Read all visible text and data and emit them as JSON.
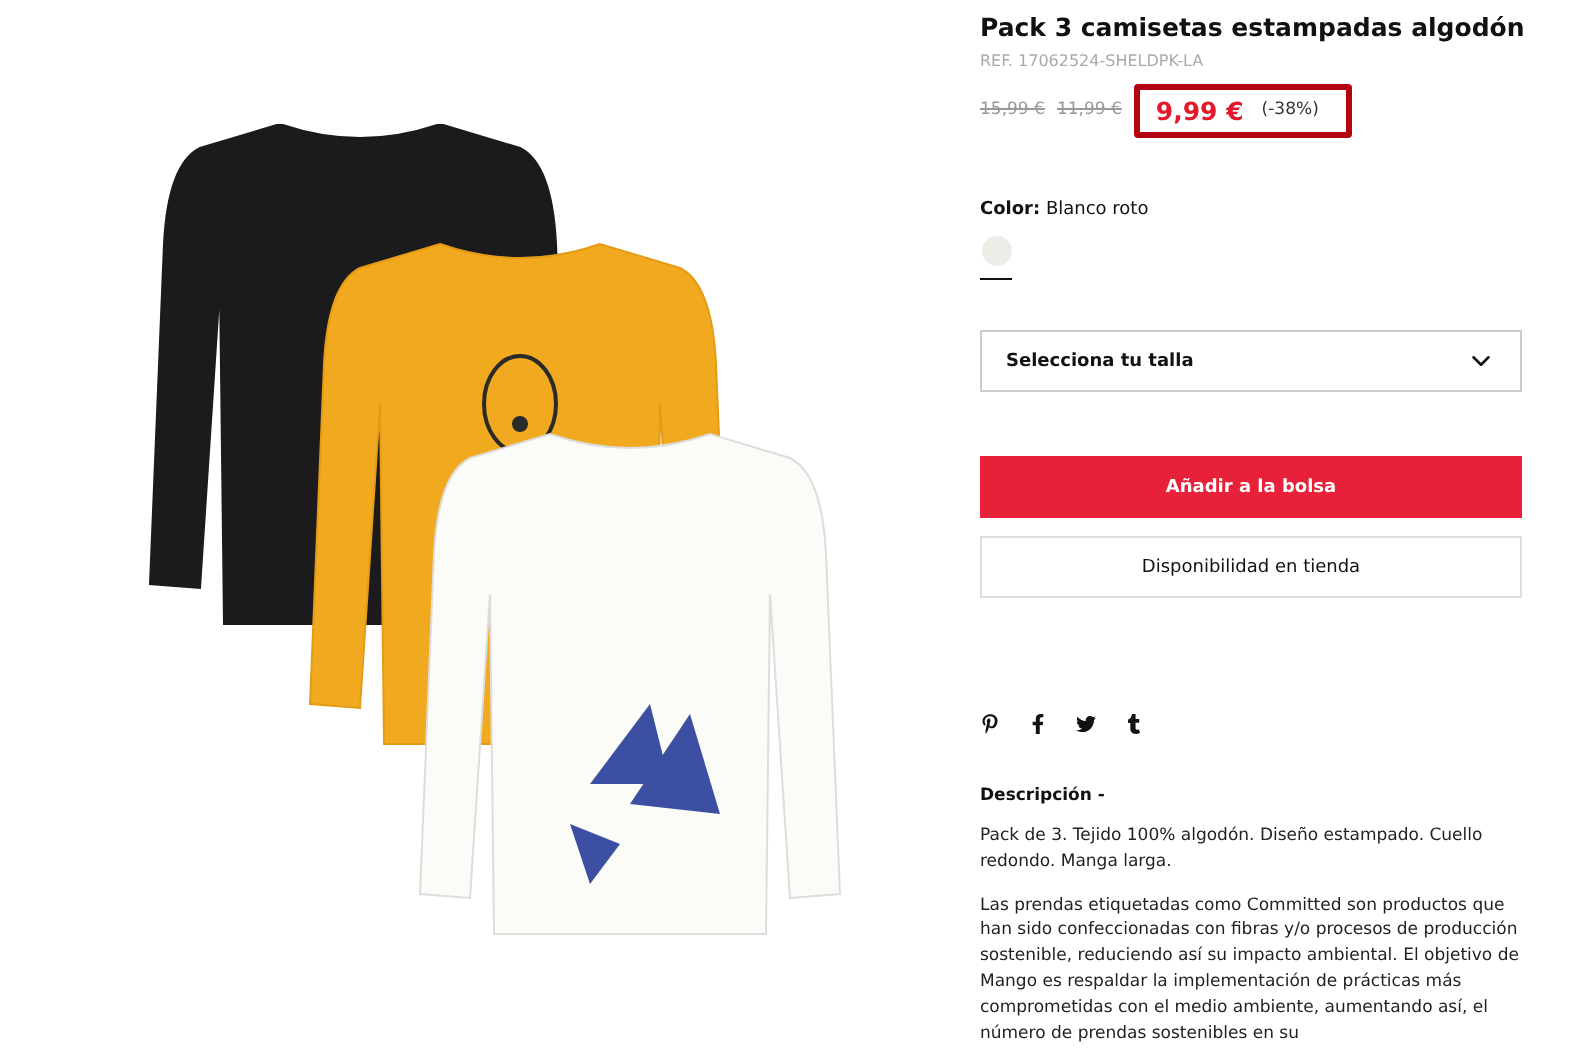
{
  "product": {
    "title": "Pack 3 camisetas estampadas algodón",
    "ref": "REF. 17062524-SHELDPK-LA",
    "old_prices": [
      "15,99 €",
      "11,99 €"
    ],
    "price": "9,99 €",
    "discount": "(-38%)",
    "color_label": "Color:",
    "color_name": "Blanco roto",
    "swatches": [
      {
        "color": "#eeece6",
        "selected": true
      }
    ],
    "size_select": {
      "placeholder": "Selecciona tu talla"
    },
    "buttons": [
      {
        "kind": "primary",
        "label": "Añadir a la bolsa"
      },
      {
        "kind": "secondary",
        "label": "Disponibilidad en tienda"
      }
    ],
    "share": [
      {
        "kind": "pinterest"
      },
      {
        "kind": "facebook"
      },
      {
        "kind": "twitter"
      },
      {
        "kind": "tumblr"
      }
    ],
    "description": {
      "title": "Descripción -",
      "paragraphs": [
        "Pack de 3. Tejido 100% algodón. Diseño estampado. Cuello redondo. Manga larga.",
        "Las prendas etiquetadas como Committed son productos que han sido confeccionadas con fibras y/o procesos de producción sostenible, reduciendo así su impacto ambiental. El objetivo de Mango es respaldar la implementación de prácticas más comprometidas con el medio ambiente, aumentando así, el número de prendas sostenibles en su"
      ]
    }
  }
}
